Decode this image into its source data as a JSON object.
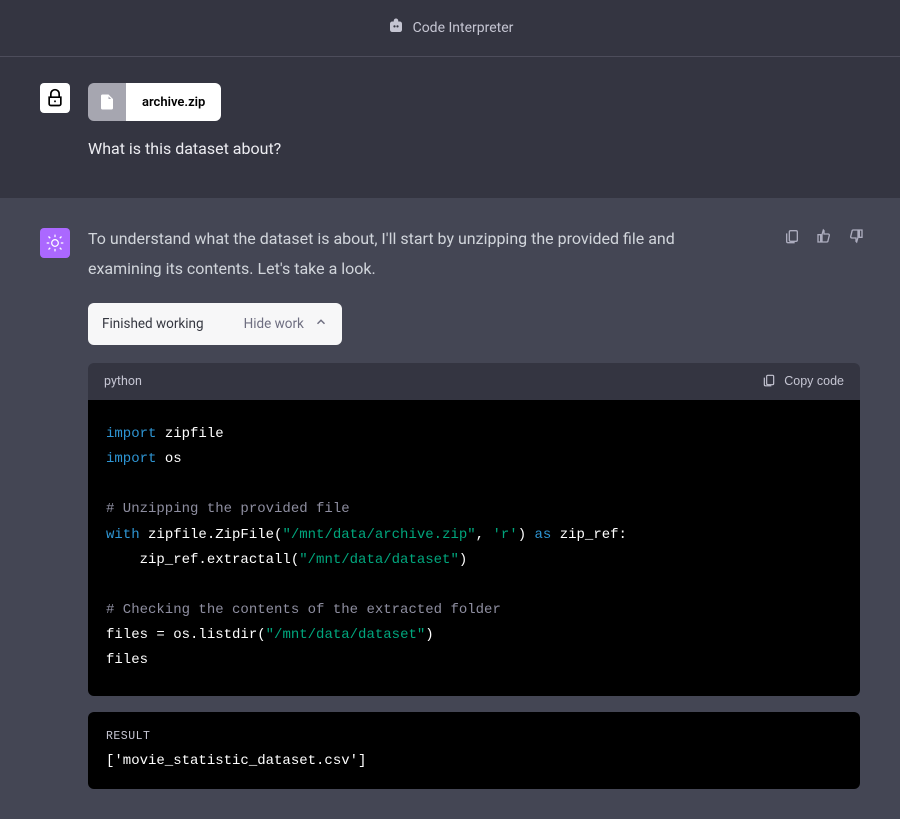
{
  "header": {
    "title": "Code Interpreter"
  },
  "user": {
    "file_name": "archive.zip",
    "prompt": "What is this dataset about?"
  },
  "assistant": {
    "text": "To understand what the dataset is about, I'll start by unzipping the provided file and examining its contents. Let's take a look.",
    "work_status": "Finished working",
    "work_toggle": "Hide work",
    "code_lang": "python",
    "copy_label": "Copy code",
    "code_tokens": {
      "kw_import1": "import",
      "mod_zipfile": " zipfile",
      "kw_import2": "import",
      "mod_os": " os",
      "cm1": "# Unzipping the provided file",
      "kw_with": "with",
      "seg1": " zipfile.ZipFile(",
      "str1": "\"/mnt/data/archive.zip\"",
      "seg2": ", ",
      "str2": "'r'",
      "seg3": ") ",
      "kw_as": "as",
      "seg4": " zip_ref:",
      "seg5": "    zip_ref.extractall(",
      "str3": "\"/mnt/data/dataset\"",
      "seg6": ")",
      "cm2": "# Checking the contents of the extracted folder",
      "seg7": "files = os.listdir(",
      "str4": "\"/mnt/data/dataset\"",
      "seg8": ")",
      "seg9": "files"
    },
    "result_label": "RESULT",
    "result_body": "['movie_statistic_dataset.csv']"
  }
}
